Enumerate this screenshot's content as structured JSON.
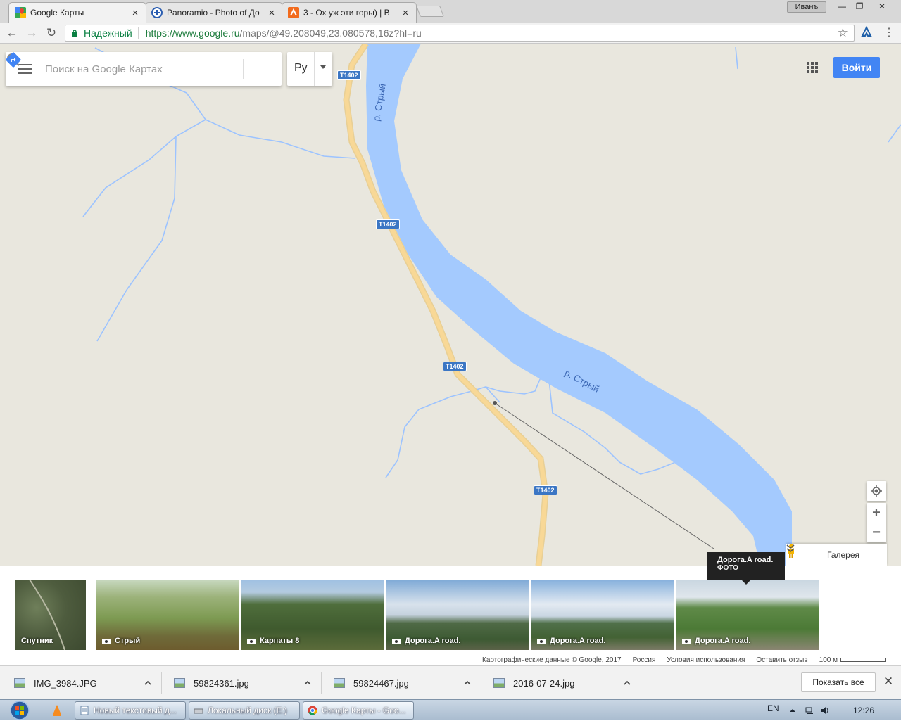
{
  "browser": {
    "tabs": [
      {
        "title": "Google Карты",
        "active": true
      },
      {
        "title": "Panoramio - Photo of До",
        "active": false
      },
      {
        "title": "3 - Ох уж эти горы)  | В",
        "active": false
      }
    ],
    "user_chip": "Иванъ",
    "window_controls": {
      "minimize": "—",
      "maximize": "❐",
      "close": "✕"
    },
    "secure_label": "Надежный",
    "url_host": "https://www.google.ru",
    "url_rest": "/maps/@49.208049,23.080578,16z?hl=ru",
    "nav": {
      "back": "←",
      "forward": "→",
      "reload": "↻",
      "star": "☆",
      "menu": "⋮"
    }
  },
  "maps": {
    "search_placeholder": "Поиск на Google Картах",
    "language": "Ру",
    "signin_label": "Войти",
    "zoom_in": "+",
    "zoom_out": "−",
    "gallery_label": "Галерея",
    "road_shield": "T1402",
    "river_label": "р. Стрый",
    "tooltip": {
      "title": "Дорога.A road.",
      "subtitle": "ФОТО"
    }
  },
  "photos": [
    {
      "caption": "Спутник",
      "camera": false
    },
    {
      "caption": "Стрый",
      "camera": true
    },
    {
      "caption": "Карпаты 8",
      "camera": true
    },
    {
      "caption": "Дорога.A road.",
      "camera": true
    },
    {
      "caption": "Дорога.A road.",
      "camera": true
    },
    {
      "caption": "Дорога.A road.",
      "camera": true
    }
  ],
  "footer": {
    "map_data": "Картографические данные © Google, 2017",
    "region": "Россия",
    "terms": "Условия использования",
    "feedback": "Оставить отзыв",
    "scale": "100 м"
  },
  "downloads": {
    "items": [
      "IMG_3984.JPG",
      "59824361.jpg",
      "59824467.jpg",
      "2016-07-24.jpg"
    ],
    "show_all": "Показать все",
    "close": "✕"
  },
  "taskbar": {
    "tasks": [
      "Новый текстовый д...",
      "Локальный диск (E:)",
      "Google Карты - Goo..."
    ],
    "language": "EN",
    "clock": "12:26"
  },
  "colors": {
    "map_land": "#e9e7de",
    "river": "#a4cafe",
    "stream": "#9cc3ff",
    "road": "#f8d896",
    "road_shield": "#3b76c4",
    "signin": "#4285f4",
    "secure": "#0b8043"
  },
  "icons": [
    "maps-favicon",
    "panoramio-favicon",
    "orange-favicon",
    "lock-icon",
    "star-icon",
    "menu-icon",
    "search-icon",
    "directions-icon",
    "apps-icon",
    "my-location-icon",
    "pegman-icon",
    "chevron-icon",
    "camera-icon",
    "image-file-icon",
    "start-orb-icon"
  ]
}
